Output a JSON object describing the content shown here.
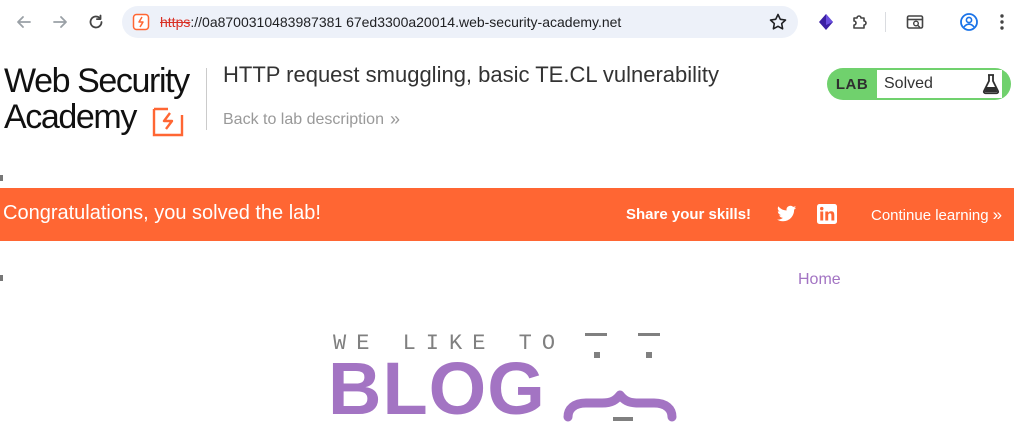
{
  "browser": {
    "url_scheme": "https",
    "url_rest": "://0a8700310483987381 67ed3300a20014.web-security-academy.net",
    "icons": [
      "back-arrow-icon",
      "forward-arrow-icon",
      "reload-icon",
      "site-info-icon",
      "bookmark-star-icon",
      "extension-purple-icon",
      "puzzle-extensions-icon",
      "tab-search-icon",
      "profile-icon",
      "kebab-menu-icon"
    ]
  },
  "header": {
    "logo_line1": "Web Security",
    "logo_line2": "Academy",
    "title": "HTTP request smuggling, basic TE.CL vulnerability",
    "back_link": "Back to lab description",
    "back_chevrons": "»",
    "status": {
      "badge": "LAB",
      "text": "Solved"
    }
  },
  "banner": {
    "message": "Congratulations, you solved the lab!",
    "share_label": "Share your skills!",
    "continue_label": "Continue learning",
    "continue_chevrons": "»"
  },
  "blog": {
    "nav_home": "Home",
    "tagline": "WE LIKE TO",
    "word": "BLOG"
  },
  "colors": {
    "accent_orange": "#ff6633",
    "status_green": "#70d16d",
    "blog_purple": "#a374c3",
    "logo_orange": "#ff6633"
  }
}
